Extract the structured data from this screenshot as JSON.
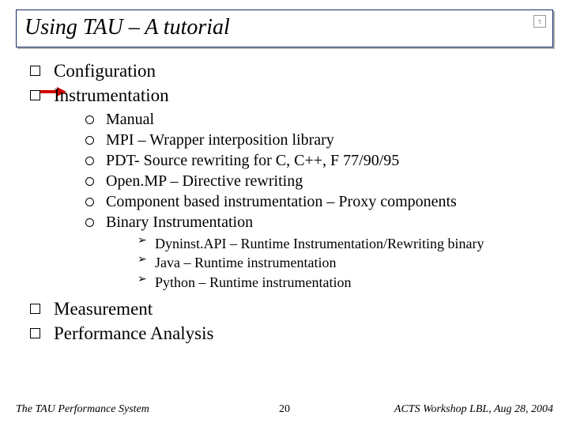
{
  "title": "Using TAU – A tutorial",
  "logo_glyph": "τ",
  "bullets": {
    "b1": "Configuration",
    "b2": "Instrumentation",
    "b2_sub": {
      "s1": "Manual",
      "s2": "MPI – Wrapper interposition library",
      "s3": "PDT- Source rewriting for C, C++, F 77/90/95",
      "s4": "Open.MP – Directive rewriting",
      "s5": "Component based instrumentation – Proxy components",
      "s6": "Binary Instrumentation",
      "s6_sub": {
        "t1": "Dyninst.API – Runtime Instrumentation/Rewriting binary",
        "t2": "Java – Runtime instrumentation",
        "t3": "Python – Runtime instrumentation"
      }
    },
    "b3": "Measurement",
    "b4": "Performance Analysis"
  },
  "footer": {
    "left": "The TAU Performance System",
    "center": "20",
    "right": "ACTS Workshop LBL, Aug 28, 2004"
  }
}
